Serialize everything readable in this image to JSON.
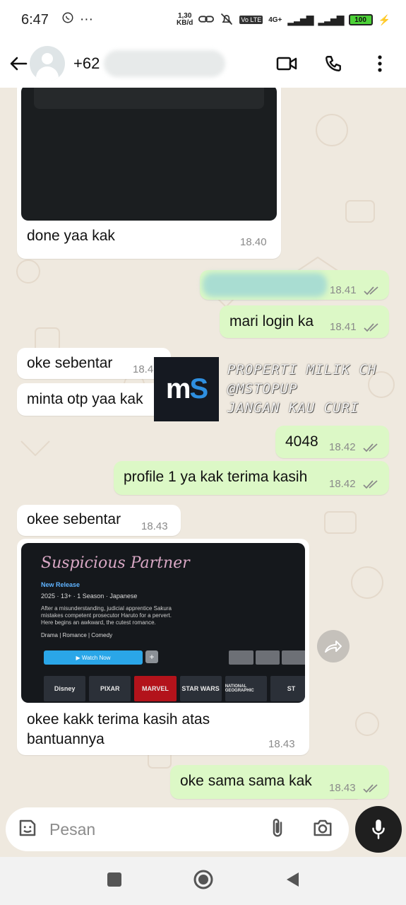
{
  "status_bar": {
    "time": "6:47",
    "more": "···",
    "net_speed_value": "1,30",
    "net_speed_unit": "KB/d",
    "volte": "Vo LTE",
    "network": "4G+",
    "battery": "100"
  },
  "header": {
    "contact": "+62"
  },
  "messages": {
    "m1": {
      "text": "done yaa kak",
      "time": "18.40"
    },
    "m2": {
      "time": "18.41"
    },
    "m3": {
      "text": "mari login ka",
      "time": "18.41"
    },
    "m4": {
      "text": "oke sebentar",
      "time": "18.4"
    },
    "m5": {
      "text": "minta otp yaa kak"
    },
    "m6": {
      "text": "4048",
      "time": "18.42"
    },
    "m7": {
      "text": "profile 1 ya kak terima kasih",
      "time": "18.42"
    },
    "m8": {
      "text": "okee sebentar",
      "time": "18.43"
    },
    "m9": {
      "text_line1": "okee kakk terima kasih atas",
      "text_line2": "bantuannya",
      "time": "18.43",
      "image": {
        "title": "Suspicious Partner",
        "badge": "New Release",
        "meta": "2025 · 13+ · 1 Season · Japanese",
        "desc": "After a misunderstanding, judicial apprentice Sakura mistakes competent prosecutor Haruto for a pervert. Here begins an awkward, the cutest romance.",
        "genres": "Drama | Romance | Comedy",
        "watch": "▶ Watch Now",
        "brands": [
          "Disney",
          "PIXAR",
          "MARVEL",
          "STAR WARS",
          "NATIONAL GEOGRAPHIC",
          "ST"
        ]
      }
    },
    "m10": {
      "text": "oke sama sama kak",
      "time": "18.43"
    }
  },
  "watermark": {
    "logo_m": "m",
    "logo_s": "S",
    "line1": "PROPERTI MILIK CH",
    "line2": "@MSTOPUP",
    "line3": "JANGAN KAU CURI"
  },
  "input": {
    "placeholder": "Pesan"
  },
  "colors": {
    "incoming": "#ffffff",
    "outgoing": "#dcf8c6",
    "wallpaper": "#efe9df",
    "ticks": "#8a8a8a"
  }
}
